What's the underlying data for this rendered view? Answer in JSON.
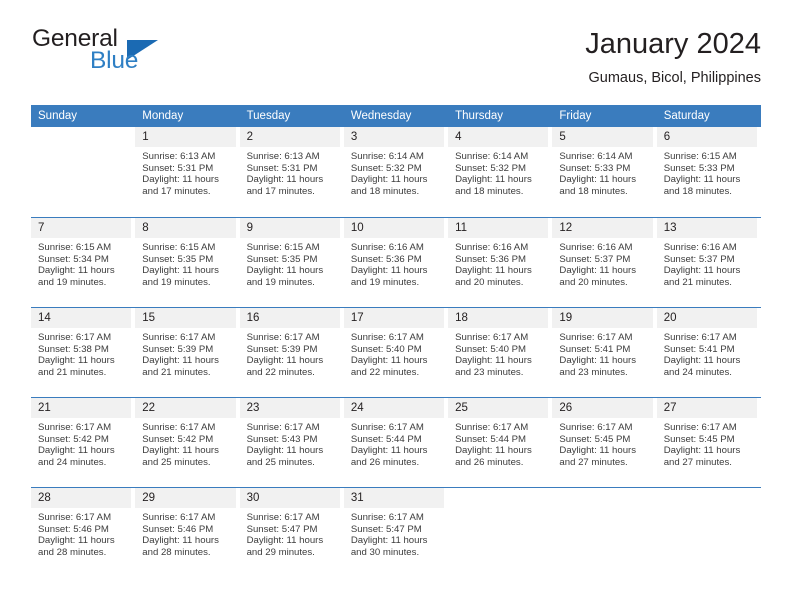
{
  "brand": {
    "name_dark": "General",
    "name_blue": "Blue",
    "triangle_icon": "triangle-icon",
    "accent_color": "#2e7fc4",
    "triangle_color": "#1b6ab3"
  },
  "header": {
    "title": "January 2024",
    "subtitle": "Gumaus, Bicol, Philippines"
  },
  "calendar": {
    "header_bg": "#3a7cbe",
    "daynum_bg": "#f1f1f1",
    "weekday_headers": [
      "Sunday",
      "Monday",
      "Tuesday",
      "Wednesday",
      "Thursday",
      "Friday",
      "Saturday"
    ],
    "weeks": [
      [
        {
          "day": ""
        },
        {
          "day": "1",
          "sunrise": "Sunrise: 6:13 AM",
          "sunset": "Sunset: 5:31 PM",
          "daylight_line1": "Daylight: 11 hours",
          "daylight_line2": "and 17 minutes."
        },
        {
          "day": "2",
          "sunrise": "Sunrise: 6:13 AM",
          "sunset": "Sunset: 5:31 PM",
          "daylight_line1": "Daylight: 11 hours",
          "daylight_line2": "and 17 minutes."
        },
        {
          "day": "3",
          "sunrise": "Sunrise: 6:14 AM",
          "sunset": "Sunset: 5:32 PM",
          "daylight_line1": "Daylight: 11 hours",
          "daylight_line2": "and 18 minutes."
        },
        {
          "day": "4",
          "sunrise": "Sunrise: 6:14 AM",
          "sunset": "Sunset: 5:32 PM",
          "daylight_line1": "Daylight: 11 hours",
          "daylight_line2": "and 18 minutes."
        },
        {
          "day": "5",
          "sunrise": "Sunrise: 6:14 AM",
          "sunset": "Sunset: 5:33 PM",
          "daylight_line1": "Daylight: 11 hours",
          "daylight_line2": "and 18 minutes."
        },
        {
          "day": "6",
          "sunrise": "Sunrise: 6:15 AM",
          "sunset": "Sunset: 5:33 PM",
          "daylight_line1": "Daylight: 11 hours",
          "daylight_line2": "and 18 minutes."
        }
      ],
      [
        {
          "day": "7",
          "sunrise": "Sunrise: 6:15 AM",
          "sunset": "Sunset: 5:34 PM",
          "daylight_line1": "Daylight: 11 hours",
          "daylight_line2": "and 19 minutes."
        },
        {
          "day": "8",
          "sunrise": "Sunrise: 6:15 AM",
          "sunset": "Sunset: 5:35 PM",
          "daylight_line1": "Daylight: 11 hours",
          "daylight_line2": "and 19 minutes."
        },
        {
          "day": "9",
          "sunrise": "Sunrise: 6:15 AM",
          "sunset": "Sunset: 5:35 PM",
          "daylight_line1": "Daylight: 11 hours",
          "daylight_line2": "and 19 minutes."
        },
        {
          "day": "10",
          "sunrise": "Sunrise: 6:16 AM",
          "sunset": "Sunset: 5:36 PM",
          "daylight_line1": "Daylight: 11 hours",
          "daylight_line2": "and 19 minutes."
        },
        {
          "day": "11",
          "sunrise": "Sunrise: 6:16 AM",
          "sunset": "Sunset: 5:36 PM",
          "daylight_line1": "Daylight: 11 hours",
          "daylight_line2": "and 20 minutes."
        },
        {
          "day": "12",
          "sunrise": "Sunrise: 6:16 AM",
          "sunset": "Sunset: 5:37 PM",
          "daylight_line1": "Daylight: 11 hours",
          "daylight_line2": "and 20 minutes."
        },
        {
          "day": "13",
          "sunrise": "Sunrise: 6:16 AM",
          "sunset": "Sunset: 5:37 PM",
          "daylight_line1": "Daylight: 11 hours",
          "daylight_line2": "and 21 minutes."
        }
      ],
      [
        {
          "day": "14",
          "sunrise": "Sunrise: 6:17 AM",
          "sunset": "Sunset: 5:38 PM",
          "daylight_line1": "Daylight: 11 hours",
          "daylight_line2": "and 21 minutes."
        },
        {
          "day": "15",
          "sunrise": "Sunrise: 6:17 AM",
          "sunset": "Sunset: 5:39 PM",
          "daylight_line1": "Daylight: 11 hours",
          "daylight_line2": "and 21 minutes."
        },
        {
          "day": "16",
          "sunrise": "Sunrise: 6:17 AM",
          "sunset": "Sunset: 5:39 PM",
          "daylight_line1": "Daylight: 11 hours",
          "daylight_line2": "and 22 minutes."
        },
        {
          "day": "17",
          "sunrise": "Sunrise: 6:17 AM",
          "sunset": "Sunset: 5:40 PM",
          "daylight_line1": "Daylight: 11 hours",
          "daylight_line2": "and 22 minutes."
        },
        {
          "day": "18",
          "sunrise": "Sunrise: 6:17 AM",
          "sunset": "Sunset: 5:40 PM",
          "daylight_line1": "Daylight: 11 hours",
          "daylight_line2": "and 23 minutes."
        },
        {
          "day": "19",
          "sunrise": "Sunrise: 6:17 AM",
          "sunset": "Sunset: 5:41 PM",
          "daylight_line1": "Daylight: 11 hours",
          "daylight_line2": "and 23 minutes."
        },
        {
          "day": "20",
          "sunrise": "Sunrise: 6:17 AM",
          "sunset": "Sunset: 5:41 PM",
          "daylight_line1": "Daylight: 11 hours",
          "daylight_line2": "and 24 minutes."
        }
      ],
      [
        {
          "day": "21",
          "sunrise": "Sunrise: 6:17 AM",
          "sunset": "Sunset: 5:42 PM",
          "daylight_line1": "Daylight: 11 hours",
          "daylight_line2": "and 24 minutes."
        },
        {
          "day": "22",
          "sunrise": "Sunrise: 6:17 AM",
          "sunset": "Sunset: 5:42 PM",
          "daylight_line1": "Daylight: 11 hours",
          "daylight_line2": "and 25 minutes."
        },
        {
          "day": "23",
          "sunrise": "Sunrise: 6:17 AM",
          "sunset": "Sunset: 5:43 PM",
          "daylight_line1": "Daylight: 11 hours",
          "daylight_line2": "and 25 minutes."
        },
        {
          "day": "24",
          "sunrise": "Sunrise: 6:17 AM",
          "sunset": "Sunset: 5:44 PM",
          "daylight_line1": "Daylight: 11 hours",
          "daylight_line2": "and 26 minutes."
        },
        {
          "day": "25",
          "sunrise": "Sunrise: 6:17 AM",
          "sunset": "Sunset: 5:44 PM",
          "daylight_line1": "Daylight: 11 hours",
          "daylight_line2": "and 26 minutes."
        },
        {
          "day": "26",
          "sunrise": "Sunrise: 6:17 AM",
          "sunset": "Sunset: 5:45 PM",
          "daylight_line1": "Daylight: 11 hours",
          "daylight_line2": "and 27 minutes."
        },
        {
          "day": "27",
          "sunrise": "Sunrise: 6:17 AM",
          "sunset": "Sunset: 5:45 PM",
          "daylight_line1": "Daylight: 11 hours",
          "daylight_line2": "and 27 minutes."
        }
      ],
      [
        {
          "day": "28",
          "sunrise": "Sunrise: 6:17 AM",
          "sunset": "Sunset: 5:46 PM",
          "daylight_line1": "Daylight: 11 hours",
          "daylight_line2": "and 28 minutes."
        },
        {
          "day": "29",
          "sunrise": "Sunrise: 6:17 AM",
          "sunset": "Sunset: 5:46 PM",
          "daylight_line1": "Daylight: 11 hours",
          "daylight_line2": "and 28 minutes."
        },
        {
          "day": "30",
          "sunrise": "Sunrise: 6:17 AM",
          "sunset": "Sunset: 5:47 PM",
          "daylight_line1": "Daylight: 11 hours",
          "daylight_line2": "and 29 minutes."
        },
        {
          "day": "31",
          "sunrise": "Sunrise: 6:17 AM",
          "sunset": "Sunset: 5:47 PM",
          "daylight_line1": "Daylight: 11 hours",
          "daylight_line2": "and 30 minutes."
        },
        {
          "day": ""
        },
        {
          "day": ""
        },
        {
          "day": ""
        }
      ]
    ]
  }
}
